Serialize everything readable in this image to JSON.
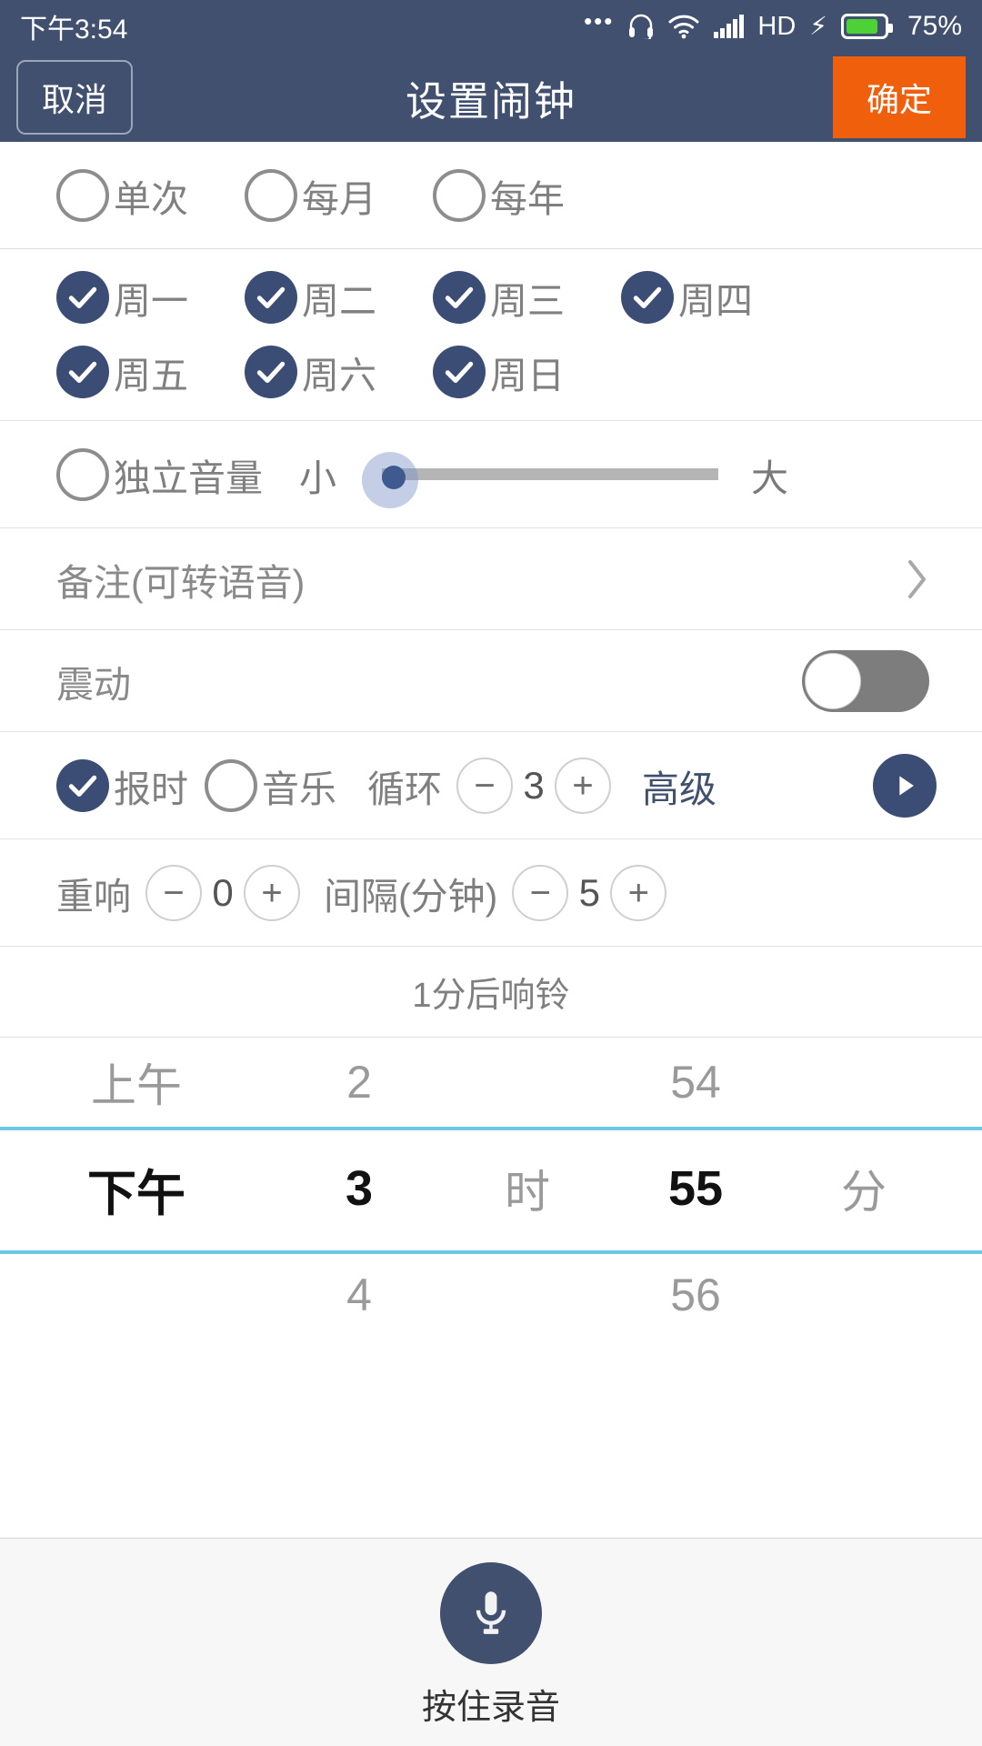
{
  "status_bar": {
    "time": "下午3:54",
    "icons": [
      "more-dots-icon",
      "headset-icon",
      "wifi-icon",
      "signal-icon",
      "hd-icon",
      "charging-bolt-icon",
      "battery-icon"
    ],
    "hd_label": "HD",
    "battery_percent": "75%",
    "battery_level": 75,
    "battery_color": "#4CD137"
  },
  "title_bar": {
    "cancel_label": "取消",
    "title": "设置闹钟",
    "confirm_label": "确定",
    "bg_color": "#41506F",
    "confirm_color": "#EF5F0C"
  },
  "repeat_type": {
    "options": [
      {
        "label": "单次",
        "checked": false
      },
      {
        "label": "每月",
        "checked": false
      },
      {
        "label": "每年",
        "checked": false
      }
    ]
  },
  "weekdays": {
    "row1": [
      {
        "label": "周一",
        "checked": true
      },
      {
        "label": "周二",
        "checked": true
      },
      {
        "label": "周三",
        "checked": true
      },
      {
        "label": "周四",
        "checked": true
      }
    ],
    "row2": [
      {
        "label": "周五",
        "checked": true
      },
      {
        "label": "周六",
        "checked": true
      },
      {
        "label": "周日",
        "checked": true
      }
    ]
  },
  "volume": {
    "label": "独立音量",
    "checked": false,
    "min_label": "小",
    "max_label": "大",
    "value": 0
  },
  "note": {
    "label": "备注(可转语音)",
    "chevron": "chevron-right-icon"
  },
  "vibrate": {
    "label": "震动",
    "enabled": false
  },
  "chime": {
    "chime_label": "报时",
    "chime_checked": true,
    "music_label": "音乐",
    "music_checked": false,
    "cycle_label": "循环",
    "cycle_minus": "−",
    "cycle_value": "3",
    "cycle_plus": "+",
    "advanced_label": "高级",
    "advanced_color": "#41506F",
    "play_icon": "play-icon"
  },
  "repeat_ring": {
    "repeat_label": "重响",
    "repeat_minus": "−",
    "repeat_value": "0",
    "repeat_plus": "+",
    "interval_label": "间隔(分钟)",
    "interval_minus": "−",
    "interval_value": "5",
    "interval_plus": "+"
  },
  "ring_in": {
    "text": "1分后响铃"
  },
  "time_picker": {
    "highlight_color": "#6FC7E8",
    "hour_unit": "时",
    "minute_unit": "分",
    "rows": {
      "previous": {
        "ampm": "上午",
        "hour": "2",
        "minute": "54"
      },
      "selected": {
        "ampm": "下午",
        "hour": "3",
        "minute": "55"
      },
      "next": {
        "ampm": "",
        "hour": "4",
        "minute": "56"
      }
    }
  },
  "record": {
    "icon": "microphone-icon",
    "label": "按住录音",
    "button_color": "#41506F"
  }
}
